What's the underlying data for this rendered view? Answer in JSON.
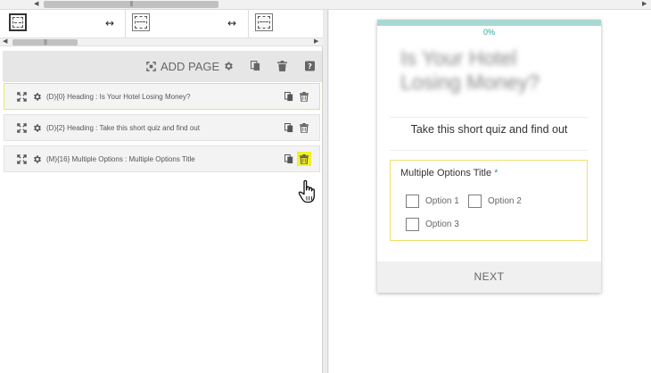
{
  "toolbar": {
    "add_page_label": "ADD PAGE"
  },
  "fields": [
    {
      "label": "(D){0} Heading : Is Your Hotel Losing Money?"
    },
    {
      "label": "(D){2} Heading : Take this short quiz and find out"
    },
    {
      "label": "(M){16} Multiple Options : Multiple Options Title"
    }
  ],
  "preview": {
    "progress_text": "0%",
    "progress_fraction": 0,
    "heading": "Is Your Hotel Losing Money?",
    "subheading": "Take this short quiz and find out",
    "question": {
      "title": "Multiple Options Title",
      "required_mark": "*",
      "options": [
        "Option 1",
        "Option 2",
        "Option 3"
      ]
    },
    "next_label": "NEXT"
  },
  "icons": {
    "expand": "expand-icon",
    "settings": "gear-icon",
    "copy": "copy-icon",
    "delete": "trash-icon",
    "help": "help-icon",
    "cursor": "hand-pointer-icon"
  },
  "colors": {
    "accent": "#26a69a",
    "highlight": "#f4f02a",
    "selected_border": "#f0de6a"
  }
}
